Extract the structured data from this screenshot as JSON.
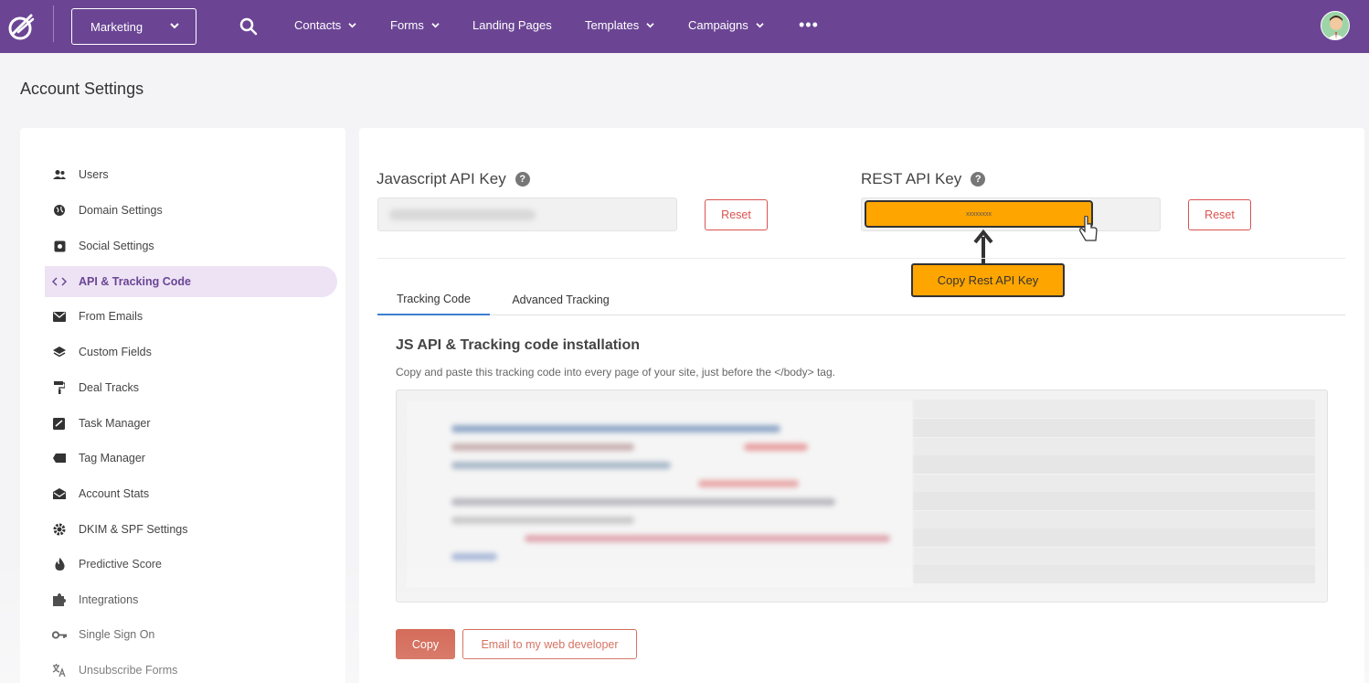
{
  "topbar": {
    "workspace": "Marketing",
    "nav": [
      {
        "label": "Contacts",
        "has_dropdown": true
      },
      {
        "label": "Forms",
        "has_dropdown": true
      },
      {
        "label": "Landing Pages",
        "has_dropdown": false
      },
      {
        "label": "Templates",
        "has_dropdown": true
      },
      {
        "label": "Campaigns",
        "has_dropdown": true
      }
    ],
    "more": "•••",
    "brand_color": "#6b4594"
  },
  "page_title": "Account Settings",
  "sidebar": {
    "items": [
      {
        "label": "Users",
        "icon": "users-icon"
      },
      {
        "label": "Domain Settings",
        "icon": "globe-icon"
      },
      {
        "label": "Social Settings",
        "icon": "social-icon"
      },
      {
        "label": "API & Tracking Code",
        "icon": "code-icon",
        "active": true
      },
      {
        "label": "From Emails",
        "icon": "envelope-icon"
      },
      {
        "label": "Custom Fields",
        "icon": "layers-icon"
      },
      {
        "label": "Deal Tracks",
        "icon": "paint-roller-icon"
      },
      {
        "label": "Task Manager",
        "icon": "task-icon"
      },
      {
        "label": "Tag Manager",
        "icon": "tag-icon"
      },
      {
        "label": "Account Stats",
        "icon": "envelope-open-icon"
      },
      {
        "label": "DKIM & SPF Settings",
        "icon": "gear-icon"
      },
      {
        "label": "Predictive Score",
        "icon": "fire-icon"
      },
      {
        "label": "Integrations",
        "icon": "puzzle-icon"
      },
      {
        "label": "Single Sign On",
        "icon": "key-icon"
      },
      {
        "label": "Unsubscribe Forms",
        "icon": "translate-icon"
      }
    ]
  },
  "main": {
    "js_key_label": "Javascript API Key",
    "rest_key_label": "REST API Key",
    "rest_key_value": "xxxxxxxx",
    "reset_label": "Reset",
    "callout": "Copy Rest API Key",
    "tabs": [
      "Tracking Code",
      "Advanced Tracking"
    ],
    "section_title": "JS API & Tracking code installation",
    "section_desc": "Copy and paste this tracking code into every page of your site, just before the </body> tag.",
    "copy_label": "Copy",
    "email_label": "Email to my web developer"
  },
  "colors": {
    "accent": "#6b4594",
    "highlight": "#ffa500",
    "danger": "#c9452f",
    "tab_active": "#3c7fd1"
  }
}
